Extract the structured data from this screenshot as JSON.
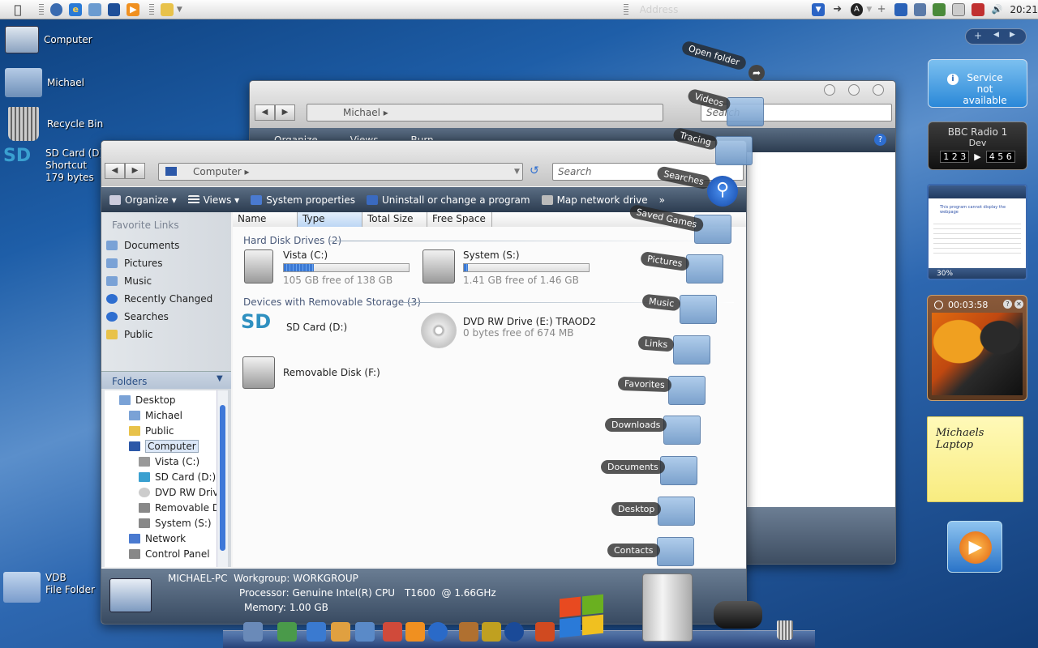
{
  "menubar": {
    "apple_icon": "apple-logo-icon",
    "address_placeholder": "Address",
    "clock": "20:21"
  },
  "desktop_icons": [
    {
      "label": "Computer",
      "icon": "computer-icon"
    },
    {
      "label": "Michael",
      "icon": "user-folder-icon"
    },
    {
      "label": "Recycle Bin",
      "icon": "recycle-bin-icon"
    },
    {
      "label": "SD Card (D)",
      "line2": "Shortcut",
      "line3": "179 bytes",
      "icon": "sd-card-icon"
    },
    {
      "label": "VDB",
      "line2": "File Folder",
      "icon": "folder-icon"
    }
  ],
  "back_window": {
    "address": "Michael",
    "search_placeholder": "Search",
    "toolbar": [
      "Organize",
      "Views",
      "Burn"
    ]
  },
  "front_window": {
    "address": "Computer",
    "search_placeholder": "Search",
    "toolbar": {
      "organize": "Organize",
      "views": "Views",
      "system_properties": "System properties",
      "uninstall": "Uninstall or change a program",
      "map_drive": "Map network drive",
      "more": "»"
    },
    "favorite_links_title": "Favorite Links",
    "favorite_links": [
      "Documents",
      "Pictures",
      "Music",
      "Recently Changed",
      "Searches",
      "Public"
    ],
    "folders_title": "Folders",
    "tree": [
      {
        "label": "Desktop",
        "indent": 0
      },
      {
        "label": "Michael",
        "indent": 1
      },
      {
        "label": "Public",
        "indent": 1
      },
      {
        "label": "Computer",
        "indent": 1,
        "selected": true
      },
      {
        "label": "Vista (C:)",
        "indent": 2
      },
      {
        "label": "SD Card (D:)",
        "indent": 2
      },
      {
        "label": "DVD RW Drive",
        "indent": 2
      },
      {
        "label": "Removable Dis",
        "indent": 2
      },
      {
        "label": "System (S:)",
        "indent": 2
      },
      {
        "label": "Network",
        "indent": 1
      },
      {
        "label": "Control Panel",
        "indent": 1
      }
    ],
    "columns": [
      "Name",
      "Type",
      "Total Size",
      "Free Space"
    ],
    "groups": {
      "hdd": "Hard Disk Drives (2)",
      "removable": "Devices with Removable Storage (3)"
    },
    "drives": {
      "vista": {
        "name": "Vista (C:)",
        "free": "105 GB free of 138 GB",
        "used_fraction": 0.24
      },
      "system": {
        "name": "System (S:)",
        "free": "1.41 GB free of 1.46 GB",
        "used_fraction": 0.03
      },
      "sd": {
        "name": "SD Card (D:)"
      },
      "dvd": {
        "name": "DVD RW Drive (E:) TRAOD2",
        "free": "0 bytes free of 674 MB"
      },
      "removable": {
        "name": "Removable Disk (F:)"
      }
    },
    "details": {
      "computer_name": "MICHAEL-PC",
      "workgroup_label": "Workgroup:",
      "workgroup": "WORKGROUP",
      "processor_label": "Processor:",
      "processor": "Genuine Intel(R) CPU",
      "processor_model": "T1600  @ 1.66GHz",
      "memory_label": "Memory:",
      "memory": "1.00 GB"
    }
  },
  "stack_labels": [
    "Open folder",
    "Videos",
    "Tracing",
    "Searches",
    "Saved Games",
    "Pictures",
    "Music",
    "Links",
    "Favorites",
    "Downloads",
    "Documents",
    "Desktop",
    "Contacts"
  ],
  "gadgets": {
    "service": "Service not available",
    "radio_title": "BBC Radio 1",
    "radio_sub": "Dev",
    "radio_presets_left": "1 2 3",
    "radio_presets_right": "4 5 6",
    "browser_zoom": "30%",
    "browser_message": "This program cannot display the webpage",
    "timer": "00:03:58",
    "note": "Michaels Laptop"
  }
}
